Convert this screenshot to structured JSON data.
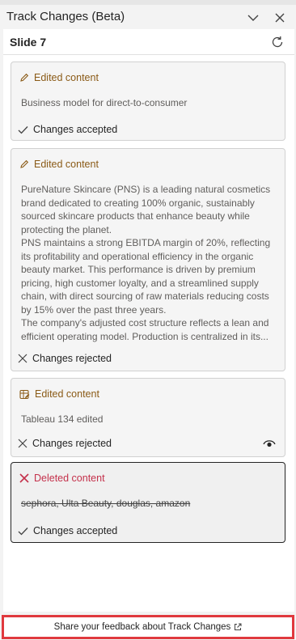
{
  "pane": {
    "title": "Track Changes (Beta)",
    "collapse_icon": "chevron-down-icon",
    "close_icon": "close-icon"
  },
  "slide": {
    "title": "Slide 7",
    "refresh_icon": "refresh-icon"
  },
  "cards": [
    {
      "type": "Edited content",
      "icon": "pencil-icon",
      "body": [
        "Business model for direct-to-consumer"
      ],
      "status": "Changes accepted",
      "status_icon": "checkmark-icon"
    },
    {
      "type": "Edited content",
      "icon": "pencil-icon",
      "body": [
        "PureNature Skincare (PNS) is a leading natural cosmetics brand dedicated to creating 100% organic, sustainably sourced skincare products that enhance beauty while protecting the planet.",
        "PNS maintains a strong EBITDA margin of 20%, reflecting its profitability and operational efficiency in the organic beauty market. This performance is driven by premium pricing, high customer loyalty, and a streamlined supply chain, with direct sourcing of raw materials reducing costs by 15% over the past three years.",
        "The company's adjusted cost structure reflects a lean and efficient operating model. Production is centralized in its..."
      ],
      "status": "Changes rejected",
      "status_icon": "dismiss-icon"
    },
    {
      "type": "Edited content",
      "icon": "table-edit-icon",
      "body": [
        "Tableau 134 edited"
      ],
      "status": "Changes rejected",
      "status_icon": "dismiss-icon",
      "extra_icon": "eye-icon"
    },
    {
      "type": "Deleted content",
      "icon": "delete-x-icon",
      "body": [
        "sephora, Ulta Beauty, douglas, amazon"
      ],
      "status": "Changes accepted",
      "status_icon": "checkmark-icon"
    }
  ],
  "footer": {
    "feedback_label": "Share your feedback about Track Changes",
    "feedback_icon": "open-external-icon"
  },
  "colors": {
    "edited_accent": "#8a5a16",
    "deleted_accent": "#c4314b",
    "highlight_border": "#e0393e"
  }
}
